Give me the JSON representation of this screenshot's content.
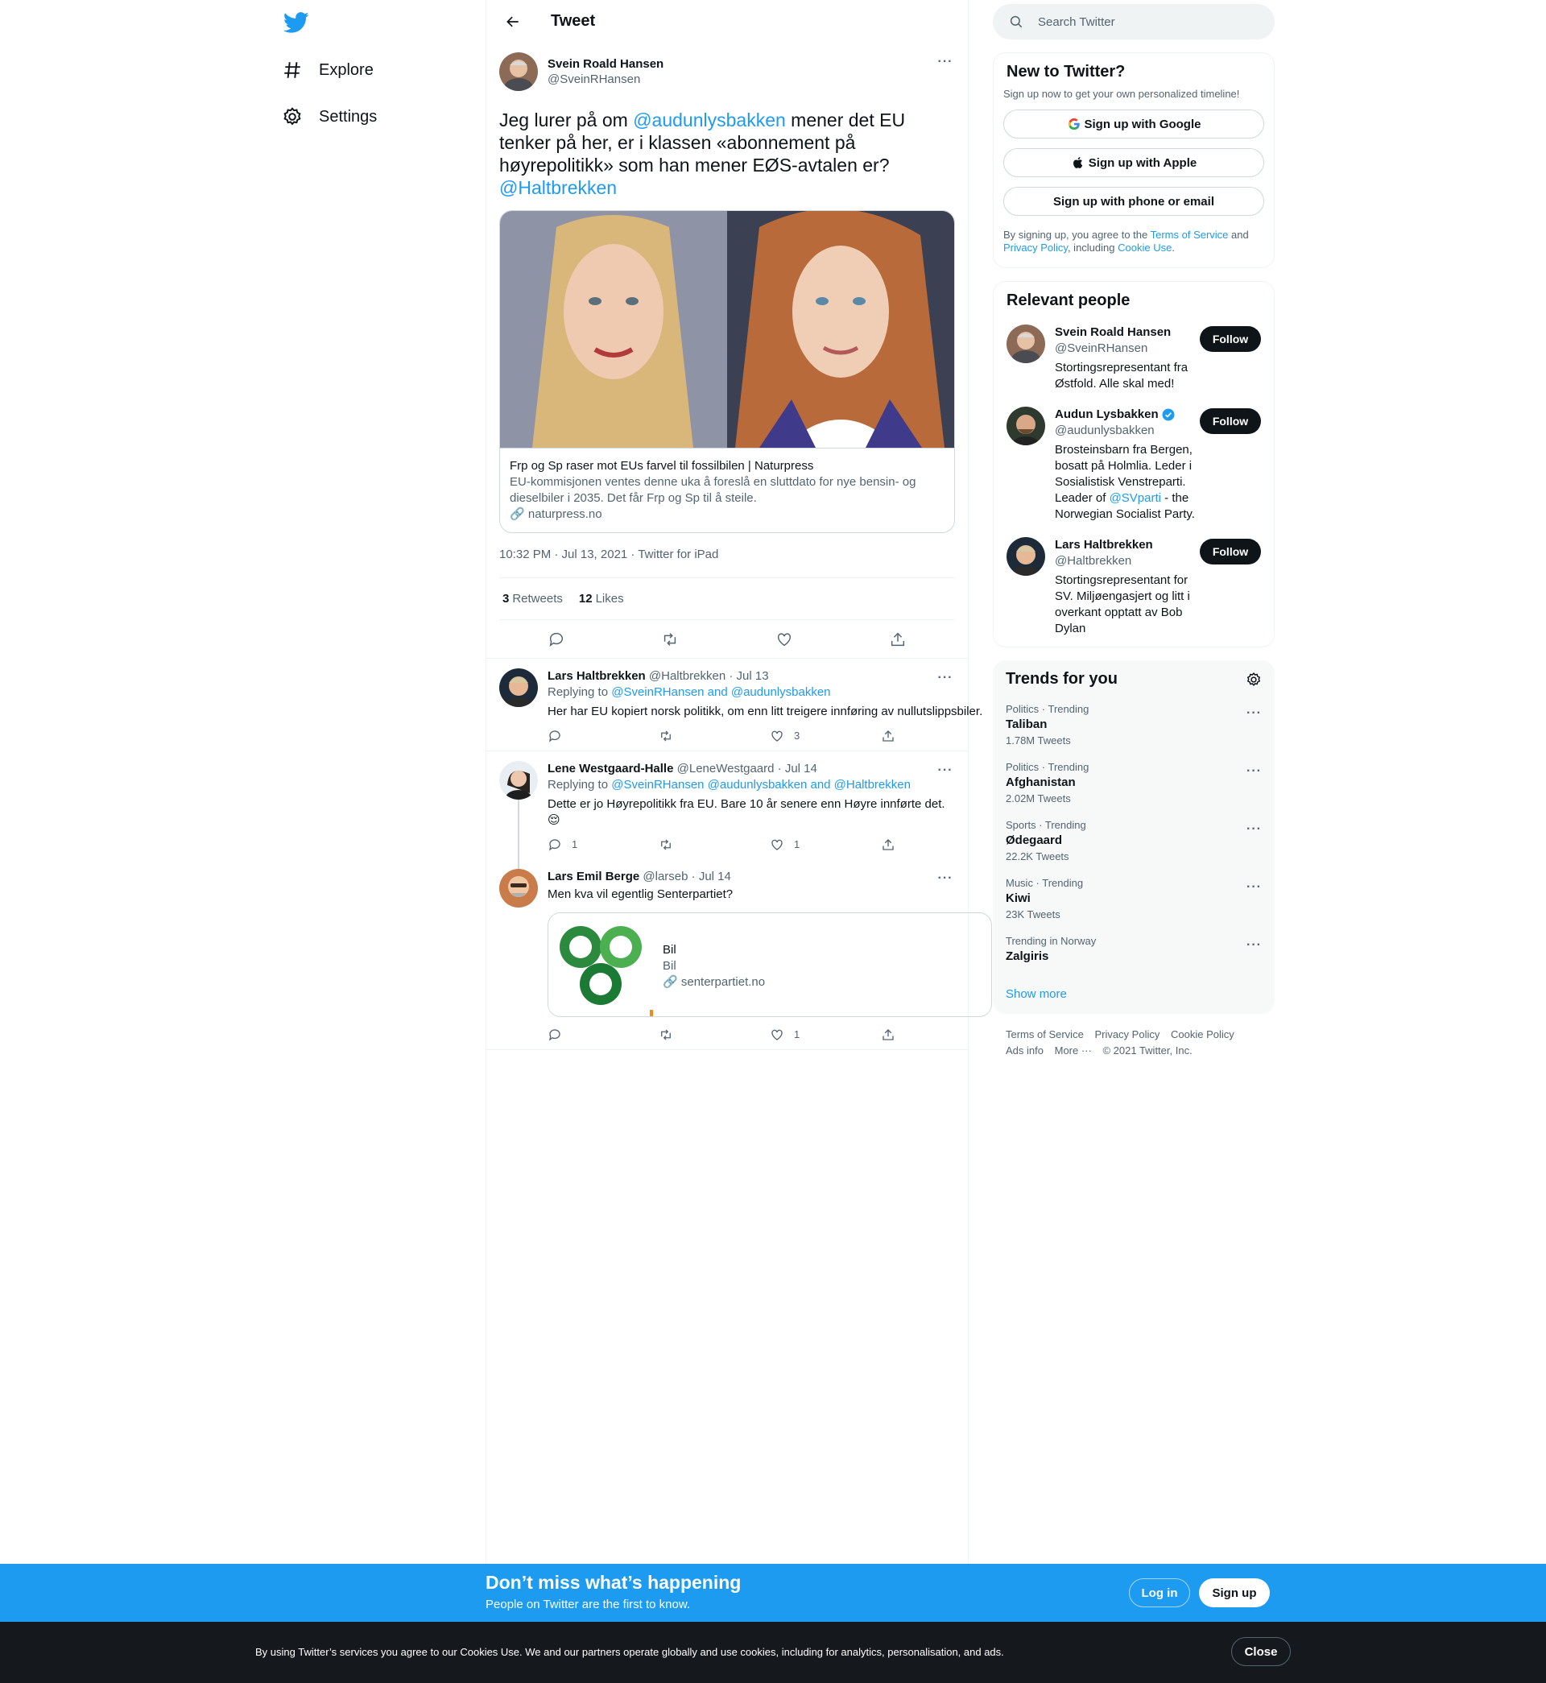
{
  "nav": {
    "explore": "Explore",
    "settings": "Settings"
  },
  "header": {
    "title": "Tweet"
  },
  "tweet": {
    "name": "Svein Roald Hansen",
    "handle": "@SveinRHansen",
    "text_1": "Jeg lurer på om ",
    "mention_1": "@audunlysbakken",
    "text_2": " mener det EU tenker på her, er i klassen «abonnement på høyrepolitikk» som han mener EØS-avtalen er? ",
    "mention_2": "@Haltbrekken",
    "card_title": "Frp og Sp raser mot EUs farvel til fossilbilen | Naturpress",
    "card_desc": "EU-kommisjonen ventes denne uka å foreslå en sluttdato for nye bensin- og dieselbiler i 2035. Det får Frp og Sp til å steile.",
    "card_domain": "naturpress.no",
    "meta": "10:32 PM · Jul 13, 2021 · Twitter for iPad",
    "retweets": "3",
    "retweets_label": "Retweets",
    "likes": "12",
    "likes_label": "Likes"
  },
  "replies": [
    {
      "name": "Lars Haltbrekken",
      "handle": "@Haltbrekken",
      "date": "· Jul 13",
      "replying": "Replying to ",
      "to": "@SveinRHansen and @audunlysbakken",
      "text": "Her har EU kopiert norsk politikk, om enn litt treigere innføring av nullutslippsbiler.",
      "replies": "",
      "retweets": "",
      "likes": "3"
    },
    {
      "name": "Lene Westgaard-Halle",
      "handle": "@LeneWestgaard",
      "date": "· Jul 14",
      "replying": "Replying to ",
      "to": "@SveinRHansen @audunlysbakken and @Haltbrekken",
      "text": "Dette er jo Høyrepolitikk fra EU. Bare 10 år senere enn Høyre innførte det.",
      "emoji": "😌",
      "replies": "1",
      "retweets": "",
      "likes": "1"
    },
    {
      "name": "Lars Emil Berge",
      "handle": "@larseb",
      "date": "· Jul 14",
      "text": "Men kva vil egentlig Senterpartiet?",
      "card_title": "Bil",
      "card_desc": "Bil",
      "card_domain": "senterpartiet.no",
      "replies": "",
      "retweets": "",
      "likes": "1"
    }
  ],
  "search": {
    "placeholder": "Search Twitter"
  },
  "new_to_twitter": {
    "title": "New to Twitter?",
    "subtitle": "Sign up now to get your own personalized timeline!",
    "google": "Sign up with Google",
    "apple": "Sign up with Apple",
    "phone": "Sign up with phone or email",
    "legal_1": "By signing up, you agree to the ",
    "tos": "Terms of Service",
    "legal_2": " and ",
    "privacy": "Privacy Policy",
    "legal_3": ", including ",
    "cookie": "Cookie Use",
    "legal_4": "."
  },
  "relevant": {
    "title": "Relevant people",
    "follow": "Follow",
    "people": [
      {
        "name": "Svein Roald Hansen",
        "handle": "@SveinRHansen",
        "bio": "Stortingsrepresentant fra Østfold. Alle skal med!"
      },
      {
        "name": "Audun Lysbakken",
        "handle": "@audunlysbakken",
        "bio_1": "Brosteinsbarn fra Bergen, bosatt på Holmlia. Leder i Sosialistisk Venstreparti. Leader of ",
        "bio_link": "@SVparti",
        "bio_2": " - the Norwegian Socialist Party."
      },
      {
        "name": "Lars Haltbrekken",
        "handle": "@Haltbrekken",
        "bio": "Stortingsrepresentant for SV. Miljøengasjert og litt i overkant opptatt av Bob Dylan"
      }
    ]
  },
  "trends": {
    "title": "Trends for you",
    "items": [
      {
        "cat": "Politics · Trending",
        "name": "Taliban",
        "count": "1.78M Tweets"
      },
      {
        "cat": "Politics · Trending",
        "name": "Afghanistan",
        "count": "2.02M Tweets"
      },
      {
        "cat": "Sports · Trending",
        "name": "Ødegaard",
        "count": "22.2K Tweets"
      },
      {
        "cat": "Music · Trending",
        "name": "Kiwi",
        "count": "23K Tweets"
      },
      {
        "cat": "Trending in Norway",
        "name": "Zalgiris",
        "count": ""
      }
    ],
    "show_more": "Show more"
  },
  "footer": {
    "tos": "Terms of Service",
    "privacy": "Privacy Policy",
    "cookie": "Cookie Policy",
    "ads": "Ads info",
    "more": "More ···",
    "copyright": "© 2021 Twitter, Inc."
  },
  "banner": {
    "title": "Don’t miss what’s happening",
    "subtitle": "People on Twitter are the first to know.",
    "login": "Log in",
    "signup": "Sign up"
  },
  "cookie_bar": {
    "text": "By using Twitter’s services you agree to our Cookies Use. We and our partners operate globally and use cookies, including for analytics, personalisation, and ads.",
    "close": "Close"
  },
  "colors": {
    "accent": "#1d9bf0",
    "text": "#0f1419",
    "muted": "#536471"
  }
}
